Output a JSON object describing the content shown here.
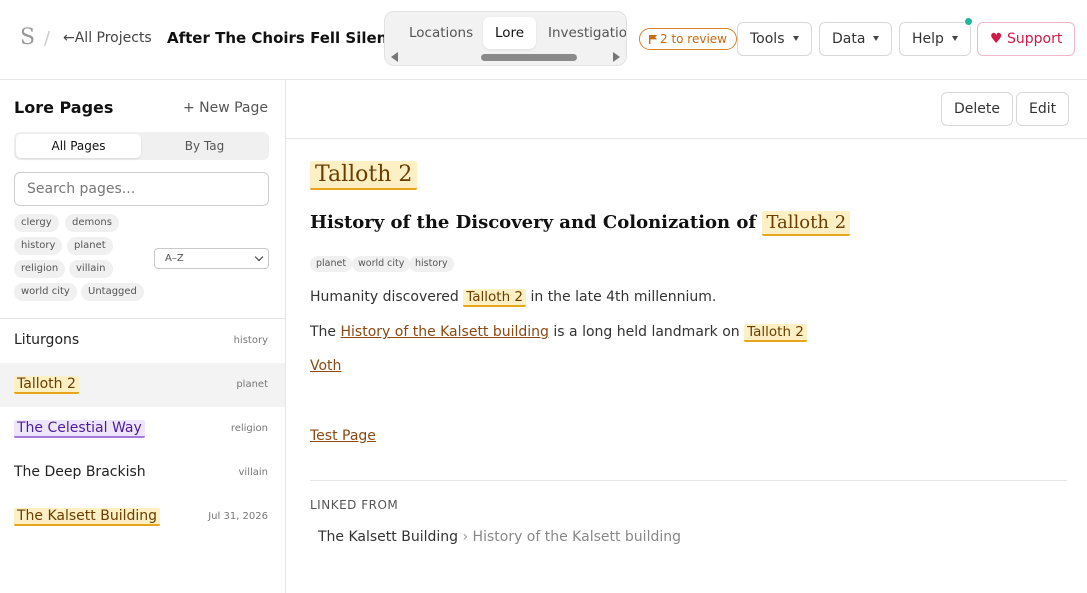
{
  "header": {
    "logo": "S",
    "separator": "/",
    "back_link": "←All Projects",
    "project_title": "After The Choirs Fell Silent",
    "tabs": [
      {
        "label": "Locations"
      },
      {
        "label": "Lore"
      },
      {
        "label": "Investigation"
      }
    ],
    "review_badge": "2 to review",
    "review_icon": "flag-icon",
    "buttons": {
      "tools": "Tools",
      "data": "Data",
      "help": "Help",
      "support": "Support"
    },
    "support_icon": "heart-icon",
    "notification_color": "#22b5a0"
  },
  "sidebar": {
    "title": "Lore Pages",
    "new_page": "+ New Page",
    "view_toggle": [
      "All Pages",
      "By Tag"
    ],
    "search_placeholder": "Search pages...",
    "tag_filters": [
      "clergy",
      "demons",
      "history",
      "planet",
      "religion",
      "villain",
      "world city",
      "Untagged"
    ],
    "sort": "A–Z",
    "pages": [
      {
        "name": "Liturgons",
        "tag": "history"
      },
      {
        "name": "Talloth 2",
        "tag": "planet"
      },
      {
        "name": "The Celestial Way",
        "tag": "religion"
      },
      {
        "name": "The Deep Brackish",
        "tag": "villain"
      },
      {
        "name": "The Kalsett Building",
        "tag": "Jul 31, 2026"
      }
    ]
  },
  "main": {
    "actions": {
      "delete": "Delete",
      "edit": "Edit"
    },
    "title": "Talloth 2",
    "subtitle_prefix": "History of the Discovery and Colonization of",
    "subtitle_mention": "Talloth 2",
    "tags": [
      "planet",
      "world city",
      "history"
    ],
    "para1": {
      "before": "Humanity discovered",
      "mention": "Talloth 2",
      "after": "in the late 4th millennium."
    },
    "para2": {
      "before": "The",
      "link": "History of the Kalsett building",
      "middle": "is a long held landmark on",
      "mention": "Talloth 2"
    },
    "link_voth": "Voth",
    "link_test": "Test Page",
    "linked_from_label": "LINKED FROM",
    "linked_from": {
      "page": "The Kalsett Building",
      "separator": "›",
      "section": "History of the Kalsett building"
    }
  },
  "colors": {
    "mention_bg": "#fdf0c4",
    "mention_border": "#e6a51a",
    "religion_bg": "#efe6fb",
    "religion_border": "#a37ad8",
    "support": "#d11a48",
    "review": "#c66a12"
  }
}
